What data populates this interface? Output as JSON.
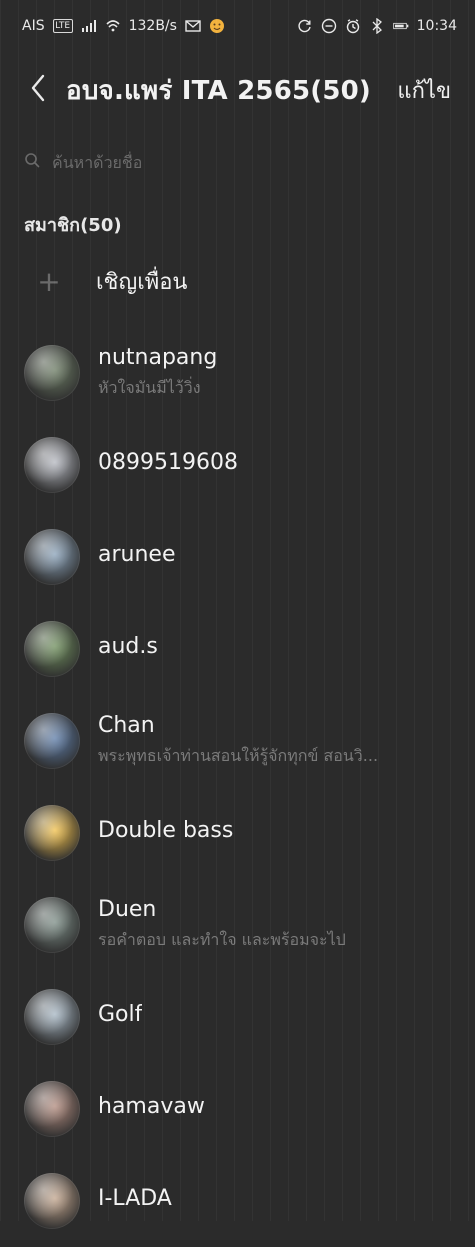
{
  "status_bar": {
    "carrier": "AIS",
    "net_badge": "LTE",
    "speed": "132B/s",
    "time": "10:34",
    "icons": [
      "signal-icon",
      "wifi-icon",
      "mail-icon",
      "emoji-icon",
      "sync-icon",
      "alarm-icon",
      "bluetooth-icon",
      "battery-icon"
    ]
  },
  "header": {
    "title": "อบจ.แพร่ ITA 2565(50)",
    "edit_label": "แก้ไข"
  },
  "search": {
    "placeholder": "ค้นหาด้วยชื่อ"
  },
  "members": {
    "section_title": "สมาชิก(50)",
    "invite_label": "เชิญเพื่อน",
    "items": [
      {
        "name": "nutnapang",
        "status": "หัวใจมันมีไว้วิ่ง",
        "avatar_color": "#6b7b63"
      },
      {
        "name": "0899519608",
        "status": "",
        "avatar_color": "#b5b8c0"
      },
      {
        "name": "arunee",
        "status": "",
        "avatar_color": "#8aa2b9"
      },
      {
        "name": "aud.s",
        "status": "",
        "avatar_color": "#6f8f5d"
      },
      {
        "name": "Chan",
        "status": "พระพุทธเจ้าท่านสอนให้รู้จักทุกข์ สอนวิ...",
        "avatar_color": "#5e7da8"
      },
      {
        "name": "Double bass",
        "status": "",
        "avatar_color": "#f1c04b"
      },
      {
        "name": "Duen",
        "status": "รอคำตอบ และทำใจ และพร้อมจะไป",
        "avatar_color": "#7c8d86"
      },
      {
        "name": "Golf",
        "status": "",
        "avatar_color": "#a6b6c3"
      },
      {
        "name": "hamavaw",
        "status": "",
        "avatar_color": "#b28b7e"
      },
      {
        "name": "I-LADA",
        "status": "",
        "avatar_color": "#c2a58d"
      }
    ]
  }
}
